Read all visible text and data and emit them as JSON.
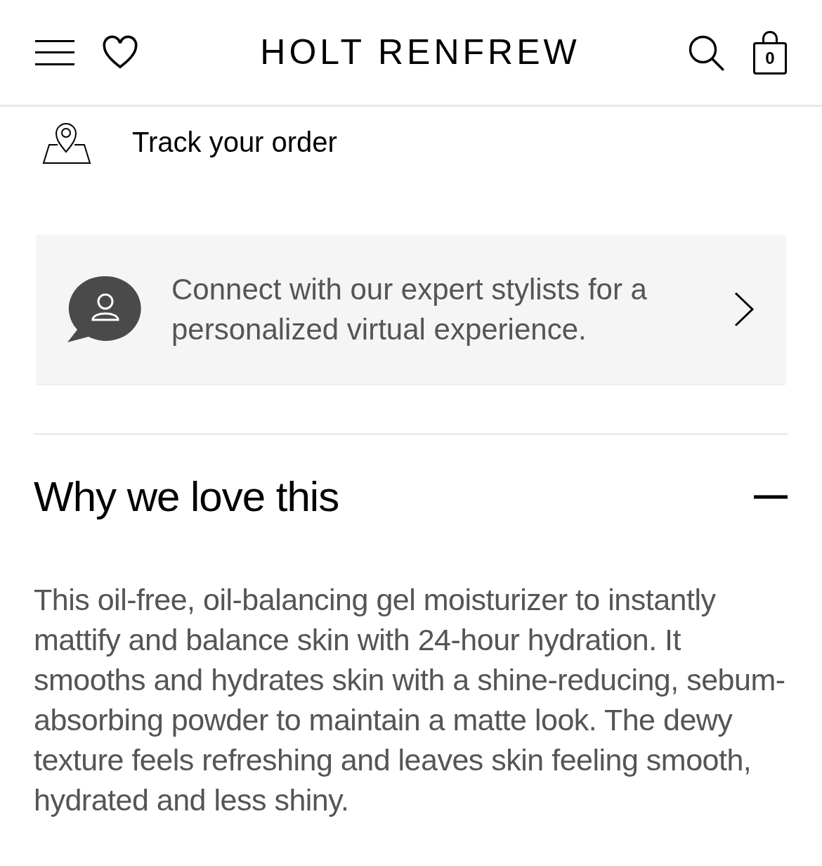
{
  "header": {
    "logo": "HOLT RENFREW",
    "bag_count": "0"
  },
  "track_order": {
    "label": "Track your order"
  },
  "stylist_banner": {
    "text": "Connect with our expert stylists for a personalized virtual experience."
  },
  "section": {
    "title": "Why we love this",
    "expanded": true,
    "body": "This oil-free, oil-balancing gel moisturizer to instantly mattify and balance skin with 24-hour hydration. It smooths and hydrates skin with a shine-reducing, sebum-absorbing powder to maintain a matte look. The dewy texture feels refreshing and leaves skin feeling smooth, hydrated and less shiny."
  }
}
